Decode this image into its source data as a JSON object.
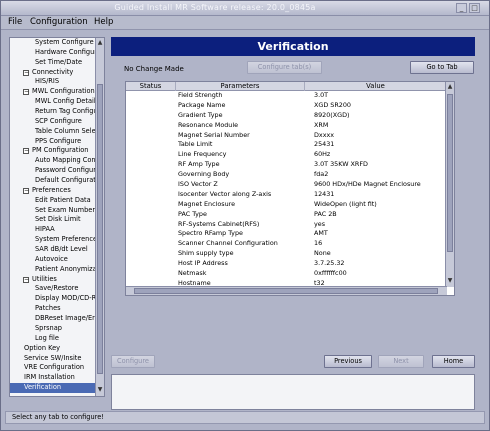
{
  "window": {
    "title": "Guided Install  MR Software release: 20.0_0845a"
  },
  "menu": {
    "items": [
      "File",
      "Configuration",
      "Help"
    ]
  },
  "tree": [
    {
      "label": "System Configure",
      "indent": 2,
      "toggle": ""
    },
    {
      "label": "Hardware Configure",
      "indent": 2,
      "toggle": ""
    },
    {
      "label": "Set Time/Date",
      "indent": 2,
      "toggle": ""
    },
    {
      "label": "Connectivity",
      "indent": 1,
      "toggle": "−"
    },
    {
      "label": "HIS/RIS",
      "indent": 2,
      "toggle": ""
    },
    {
      "label": "MWL Configuration",
      "indent": 1,
      "toggle": "−"
    },
    {
      "label": "MWL Config Details",
      "indent": 2,
      "toggle": ""
    },
    {
      "label": "Return Tag Configure",
      "indent": 2,
      "toggle": ""
    },
    {
      "label": "SCP Configure",
      "indent": 2,
      "toggle": ""
    },
    {
      "label": "Table Column Select",
      "indent": 2,
      "toggle": ""
    },
    {
      "label": "PPS Configure",
      "indent": 2,
      "toggle": ""
    },
    {
      "label": "PM Configuration",
      "indent": 1,
      "toggle": "−"
    },
    {
      "label": "Auto Mapping Config",
      "indent": 2,
      "toggle": ""
    },
    {
      "label": "Password Configure",
      "indent": 2,
      "toggle": ""
    },
    {
      "label": "Default Configuration",
      "indent": 2,
      "toggle": ""
    },
    {
      "label": "Preferences",
      "indent": 1,
      "toggle": "−"
    },
    {
      "label": "Edit Patient Data",
      "indent": 2,
      "toggle": ""
    },
    {
      "label": "Set Exam Number",
      "indent": 2,
      "toggle": ""
    },
    {
      "label": "Set Disk Limit",
      "indent": 2,
      "toggle": ""
    },
    {
      "label": "HIPAA",
      "indent": 2,
      "toggle": ""
    },
    {
      "label": "System Preferences",
      "indent": 2,
      "toggle": ""
    },
    {
      "label": "SAR dB/dt Level",
      "indent": 2,
      "toggle": ""
    },
    {
      "label": "Autovoice",
      "indent": 2,
      "toggle": ""
    },
    {
      "label": "Patient Anonymization",
      "indent": 2,
      "toggle": ""
    },
    {
      "label": "Utilities",
      "indent": 1,
      "toggle": "−"
    },
    {
      "label": "Save/Restore",
      "indent": 2,
      "toggle": ""
    },
    {
      "label": "Display MOD/CD-ROM",
      "indent": 2,
      "toggle": ""
    },
    {
      "label": "Patches",
      "indent": 2,
      "toggle": ""
    },
    {
      "label": "DBReset Image/Error",
      "indent": 2,
      "toggle": ""
    },
    {
      "label": "Sprsnap",
      "indent": 2,
      "toggle": ""
    },
    {
      "label": "Log file",
      "indent": 2,
      "toggle": ""
    },
    {
      "label": "Option Key",
      "indent": 0,
      "toggle": ""
    },
    {
      "label": "Service SW/Insite",
      "indent": 0,
      "toggle": ""
    },
    {
      "label": "VRE Configuration",
      "indent": 0,
      "toggle": ""
    },
    {
      "label": "IRM Installation",
      "indent": 0,
      "toggle": ""
    },
    {
      "label": "Verification",
      "indent": 0,
      "toggle": "",
      "selected": true
    }
  ],
  "main": {
    "header": "Verification",
    "status": "No Change Made",
    "configure_tab_label": "Configure tab(s)",
    "goto_tab_label": "Go to Tab",
    "configure_label": "Configure",
    "previous_label": "Previous",
    "next_label": "Next",
    "home_label": "Home"
  },
  "table": {
    "columns": [
      "Status",
      "Parameters",
      "Value"
    ],
    "rows": [
      {
        "param": "Field Strength",
        "value": "3.0T"
      },
      {
        "param": "Package Name",
        "value": "XGD SR200"
      },
      {
        "param": "Gradient Type",
        "value": "8920(XGD)"
      },
      {
        "param": "Resonance Module",
        "value": "XRM"
      },
      {
        "param": "Magnet Serial Number",
        "value": "Dxxxx"
      },
      {
        "param": "Table Limit",
        "value": "25431"
      },
      {
        "param": "Line Frequency",
        "value": "60Hz"
      },
      {
        "param": "RF Amp Type",
        "value": "3.0T 35KW XRFD"
      },
      {
        "param": "Governing Body",
        "value": "fda2"
      },
      {
        "param": "ISO Vector Z",
        "value": "9600 HDx/HDe Magnet Enclosure"
      },
      {
        "param": "Isocenter Vector along Z-axis",
        "value": "12431"
      },
      {
        "param": "Magnet Enclosure",
        "value": "WideOpen (light fit)"
      },
      {
        "param": "PAC Type",
        "value": "PAC 2B"
      },
      {
        "param": "RF-Systems Cabinet(RFS)",
        "value": "yes"
      },
      {
        "param": "Spectro RFamp Type",
        "value": "AMT"
      },
      {
        "param": "Scanner Channel Configuration",
        "value": "16"
      },
      {
        "param": "Shim supply type",
        "value": "None"
      },
      {
        "param": "Host IP Address",
        "value": "3.7.25.32"
      },
      {
        "param": "Netmask",
        "value": "0xffffffc00"
      },
      {
        "param": "Hostname",
        "value": "t32"
      }
    ]
  },
  "statusbar": {
    "text": "Select any tab to configure!"
  }
}
